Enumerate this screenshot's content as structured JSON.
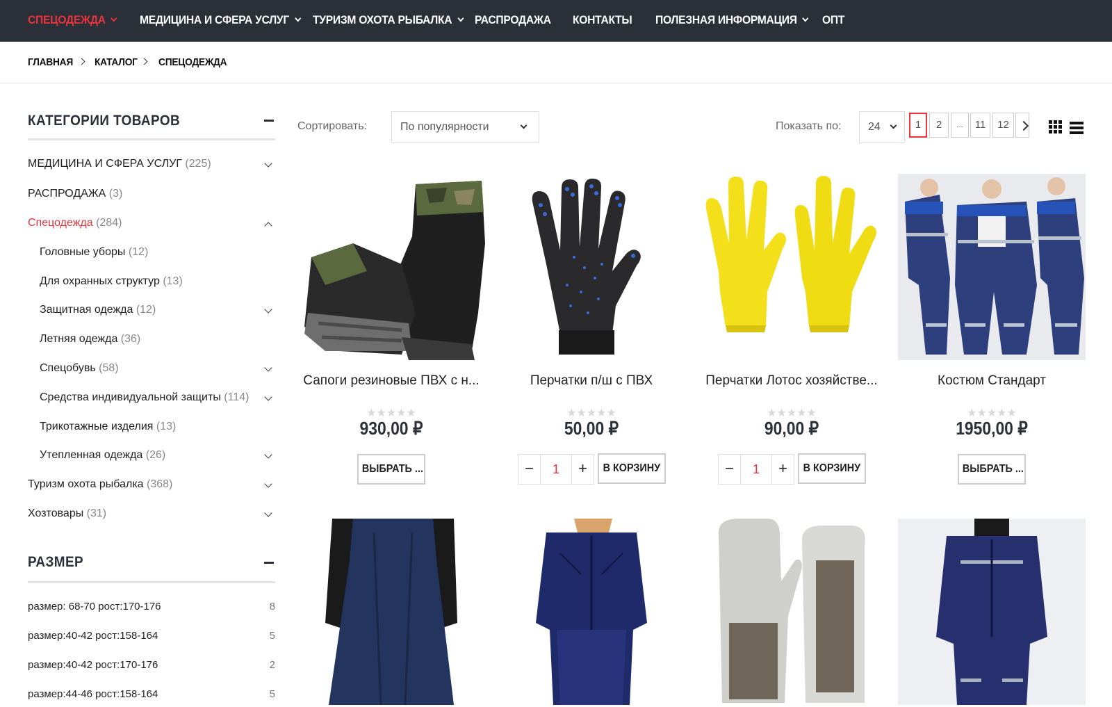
{
  "nav": {
    "items": [
      {
        "label": "СПЕЦОДЕЖДА",
        "active": true,
        "dropdown": true
      },
      {
        "label": "МЕДИЦИНА И СФЕРА УСЛУГ",
        "dropdown": true
      },
      {
        "label": "ТУРИЗМ ОХОТА РЫБАЛКА",
        "dropdown": true
      },
      {
        "label": "РАСПРОДАЖА",
        "dropdown": false
      },
      {
        "label": "КОНТАКТЫ",
        "dropdown": false
      },
      {
        "label": "ПОЛЕЗНАЯ ИНФОРМАЦИЯ",
        "dropdown": true
      },
      {
        "label": "ОПТ",
        "dropdown": false
      }
    ]
  },
  "breadcrumb": [
    "ГЛАВНАЯ",
    "КАТАЛОГ",
    "СПЕЦОДЕЖДА"
  ],
  "sidebar": {
    "categories_title": "КАТЕГОРИИ ТОВАРОВ",
    "categories": [
      {
        "label": "МЕДИЦИНА И СФЕРА УСЛУГ",
        "count": "(225)"
      },
      {
        "label": "РАСПРОДАЖА",
        "count": "(3)"
      },
      {
        "label": "Спецодежда",
        "count": "(284)"
      },
      {
        "label": "Головные уборы",
        "count": "(12)"
      },
      {
        "label": "Для охранных структур",
        "count": "(13)"
      },
      {
        "label": "Защитная одежда",
        "count": "(12)"
      },
      {
        "label": "Летняя одежда",
        "count": "(36)"
      },
      {
        "label": "Спецобувь",
        "count": "(58)"
      },
      {
        "label": "Средства индивидуальной защиты",
        "count": "(114)"
      },
      {
        "label": "Трикотажные изделия",
        "count": "(13)"
      },
      {
        "label": "Утепленная одежда",
        "count": "(26)"
      },
      {
        "label": "Туризм охота рыбалка",
        "count": "(368)"
      },
      {
        "label": "Хозтовары",
        "count": "(31)"
      }
    ],
    "size_title": "РАЗМЕР",
    "sizes": [
      {
        "label": "размер: 68-70 рост:170-176",
        "count": "8"
      },
      {
        "label": "размер:40-42 рост:158-164",
        "count": "5"
      },
      {
        "label": "размер:40-42 рост:170-176",
        "count": "2"
      },
      {
        "label": "размер:44-46 рост:158-164",
        "count": "5"
      }
    ]
  },
  "toolbar": {
    "sort_label": "Сортировать:",
    "sort_value": "По популярности",
    "show_label": "Показать по:",
    "show_value": "24",
    "pages": [
      "1",
      "2",
      "...",
      "11",
      "12"
    ]
  },
  "products": [
    {
      "name": "Сапоги резиновые ПВХ с н...",
      "stars": "★★★★★",
      "price": "930,00 ₽",
      "action": "ВЫБРАТЬ ..."
    },
    {
      "name": "Перчатки п/ш с ПВХ",
      "stars": "★★★★★",
      "price": "50,00 ₽",
      "action": "В КОРЗИНУ",
      "qty": "1"
    },
    {
      "name": "Перчатки Лотос хозяйстве...",
      "stars": "★★★★★",
      "price": "90,00 ₽",
      "action": "В КОРЗИНУ",
      "qty": "1"
    },
    {
      "name": "Костюм Стандарт",
      "stars": "★★★★★",
      "price": "1950,00 ₽",
      "action": "ВЫБРАТЬ ..."
    }
  ],
  "qty_controls": {
    "minus": "−",
    "plus": "+"
  },
  "colors": {
    "accent": "#e8343c",
    "nav_bg": "#2b2f38"
  }
}
